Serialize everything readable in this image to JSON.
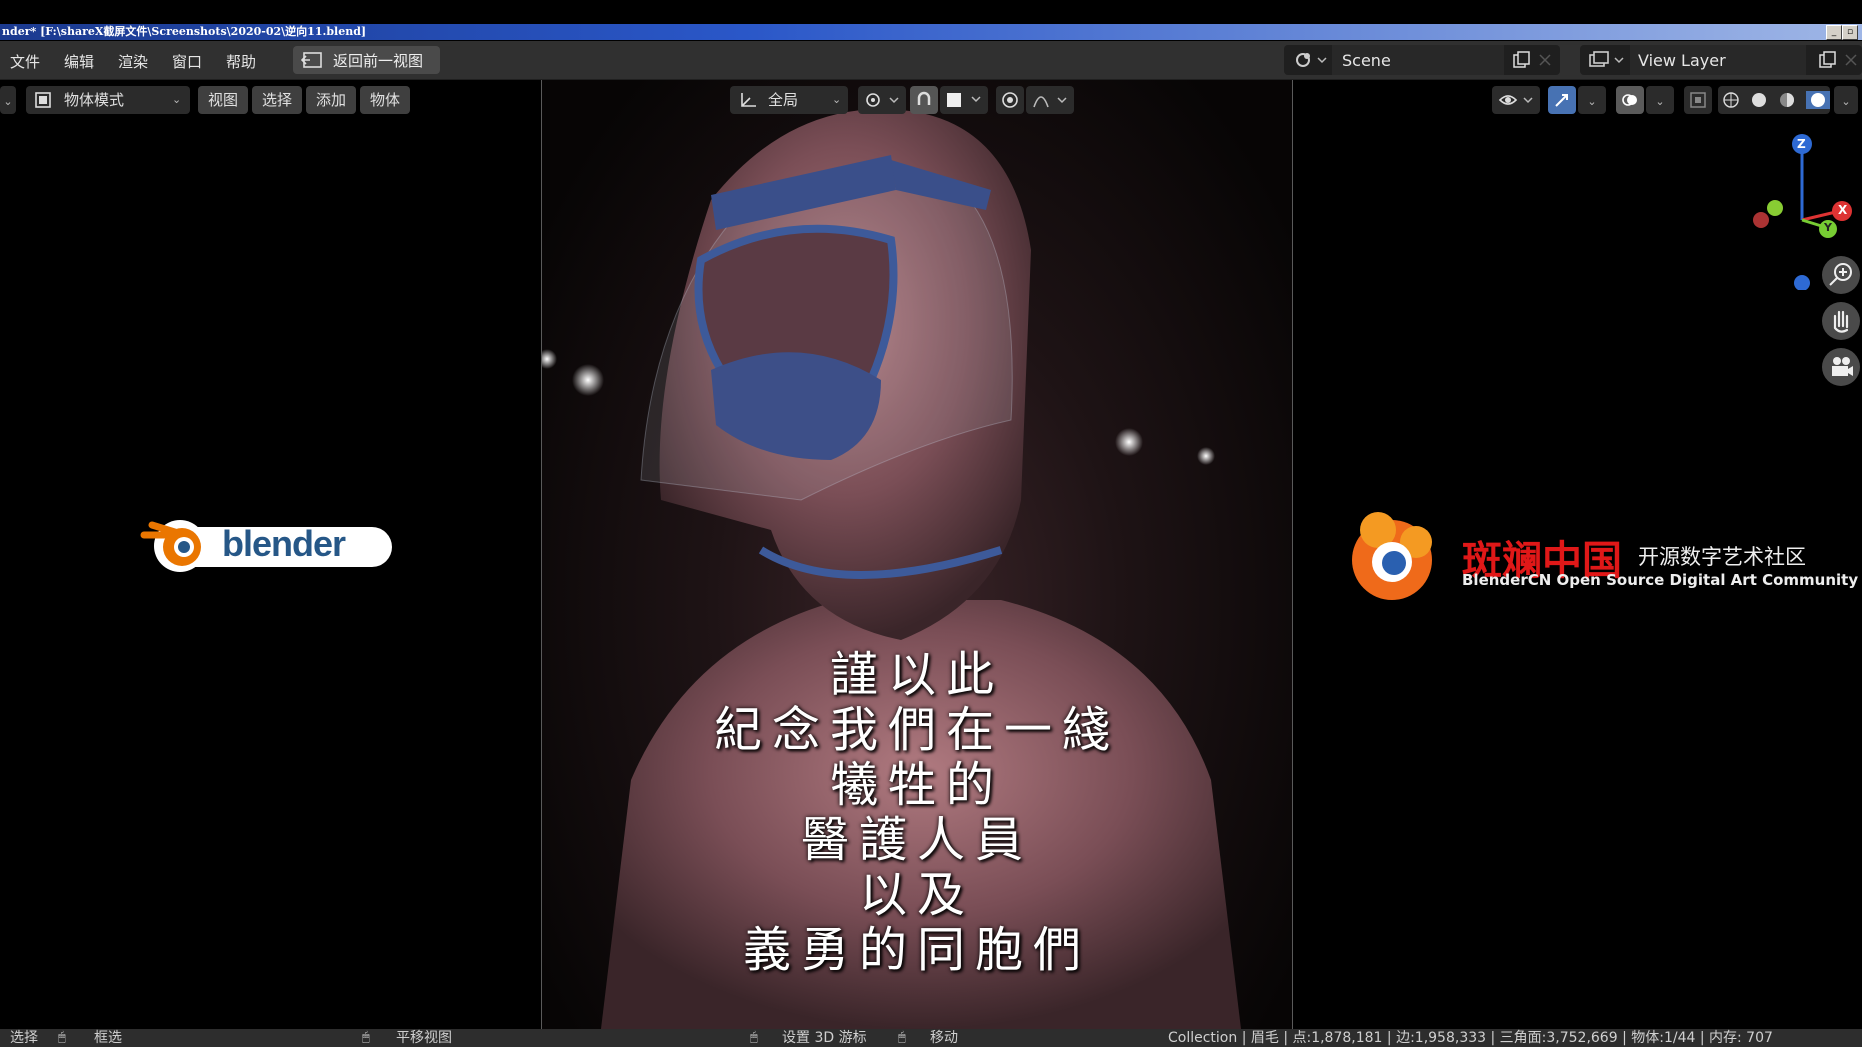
{
  "window": {
    "title": "nder* [F:\\shareX截屏文件\\Screenshots\\2020-02\\逆向11.blend]"
  },
  "menubar": {
    "items": [
      "文件",
      "编辑",
      "渲染",
      "窗口",
      "帮助"
    ],
    "back_button": "返回前一视图",
    "scene": "Scene",
    "view_layer": "View Layer"
  },
  "viewport_header": {
    "mode": "物体模式",
    "view": "视图",
    "select": "选择",
    "add": "添加",
    "object": "物体",
    "orientation": "全局"
  },
  "gizmo": {
    "z": "Z",
    "x": "X",
    "y": "Y"
  },
  "logos": {
    "blender": "blender",
    "blendercn_title": "开源数字艺术社区",
    "blendercn_subtitle": "BlenderCN Open Source Digital Art Community"
  },
  "subtitles": [
    "謹以此",
    "紀念我們在一綫",
    "犧牲的",
    "醫護人員",
    "以及",
    "義勇的同胞們"
  ],
  "statusbar": {
    "select": "选择",
    "box_select": "框选",
    "pan_view": "平移视图",
    "set_cursor": "设置 3D 游标",
    "move": "移动",
    "stats": "Collection | 眉毛 | 点:1,878,181 | 边:1,958,333 | 三角面:3,752,669 | 物体:1/44 | 内存: 707"
  },
  "colors": {
    "accent": "#4772b3",
    "header_bg": "#303030",
    "status_bg": "#2d2d2d"
  }
}
